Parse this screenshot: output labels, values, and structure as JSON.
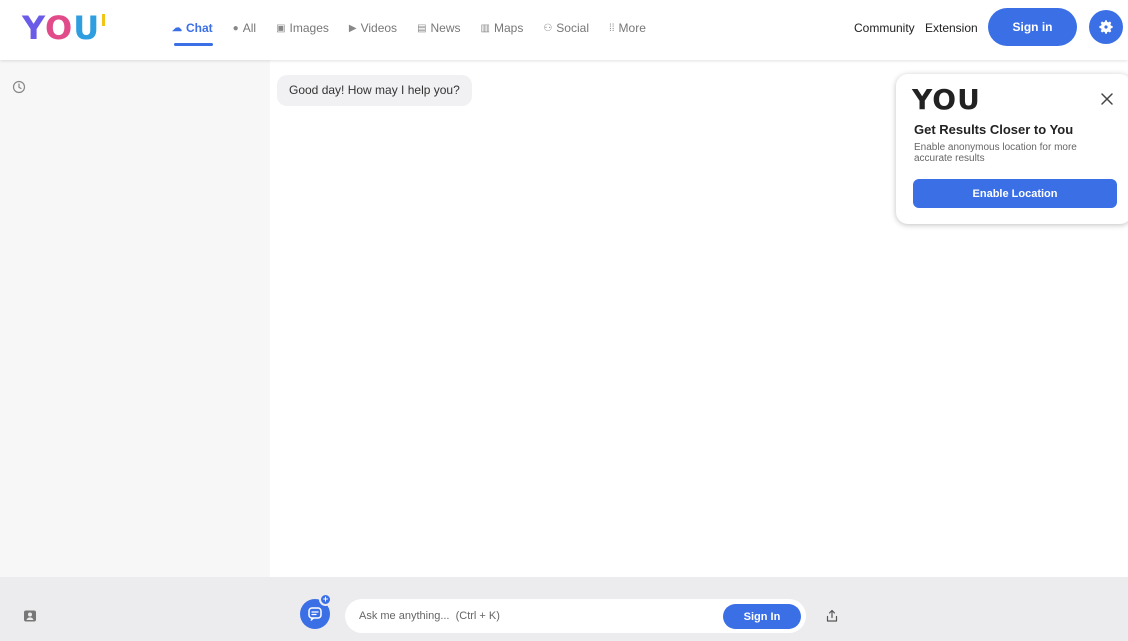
{
  "header": {
    "logo": "YOU",
    "nav": [
      {
        "label": "Chat",
        "icon": "chat-icon",
        "active": true
      },
      {
        "label": "All",
        "icon": "globe-icon"
      },
      {
        "label": "Images",
        "icon": "images-icon"
      },
      {
        "label": "Videos",
        "icon": "videos-icon"
      },
      {
        "label": "News",
        "icon": "news-icon"
      },
      {
        "label": "Maps",
        "icon": "maps-icon"
      },
      {
        "label": "Social",
        "icon": "social-icon"
      },
      {
        "label": "More",
        "icon": "grid-dots-icon"
      }
    ],
    "community": "Community",
    "extension": "Extension",
    "signin": "Sign in"
  },
  "chat": {
    "greeting": "Good day! How may I help you?"
  },
  "popup": {
    "logo": "YOU",
    "title": "Get Results Closer to You",
    "description": "Enable anonymous location for more accurate results",
    "button": "Enable Location"
  },
  "input": {
    "placeholder": "Ask me anything...  (Ctrl + K)",
    "signin": "Sign In"
  },
  "colors": {
    "accent": "#3b6fe6",
    "sidebar_bg": "#f7f7f8",
    "bottom_bg": "#ececee"
  }
}
